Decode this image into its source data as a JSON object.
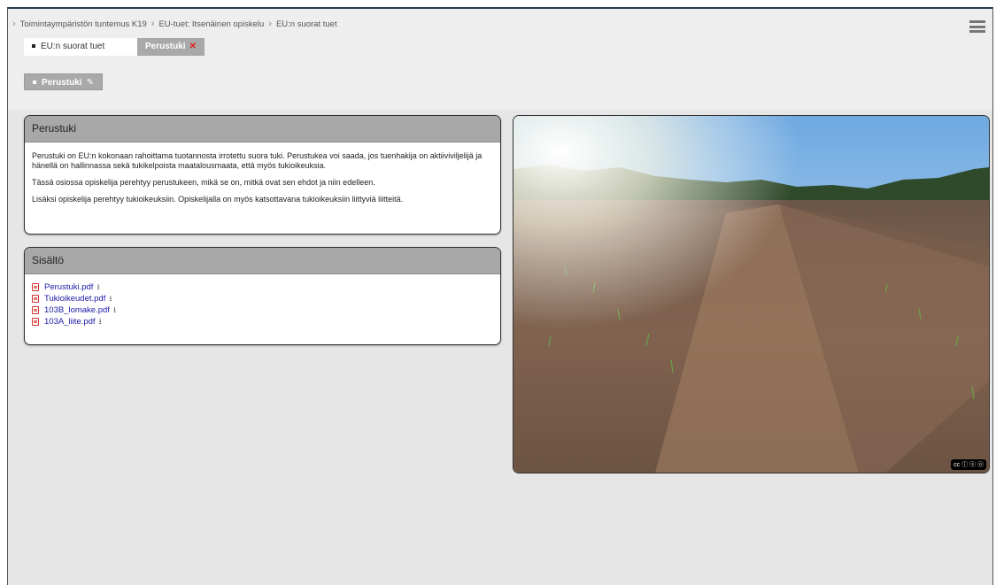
{
  "breadcrumb": {
    "items": [
      "Toimintaympäristön tuntemus K19",
      "EU-tuet: Itsenäinen opiskelu",
      "EU:n suorat tuet"
    ]
  },
  "tabs": {
    "inactive_label": "EU:n suorat tuet",
    "active_label": "Perustuki",
    "close_symbol": "✕"
  },
  "subtab": {
    "label": "Perustuki"
  },
  "info_panel": {
    "title": "Perustuki",
    "paragraphs": [
      "Perustuki on EU:n kokonaan rahoittama tuotannosta irrotettu suora tuki. Perustukea voi saada, jos tuenhakija on aktiiviviljelijä ja hänellä on hallinnassa sekä tukikelpoista maatalousmaata, että myös tukioikeuksia.",
      "Tässä osiossa opiskelija perehtyy perustukeen, mikä se on, mitkä ovat sen ehdot ja niin edelleen.",
      "Lisäksi opiskelija perehtyy tukioikeuksiin. Opiskelijalla on myös katsottavana tukioikeuksiin liittyviä liitteitä."
    ]
  },
  "content_panel": {
    "title": "Sisältö",
    "files": [
      "Perustuki.pdf",
      "Tukioikeudet.pdf",
      "103B_lomake.pdf",
      "103A_liite.pdf"
    ]
  },
  "photo": {
    "license_badge": "cc ⓘ ⓢ ⓞ"
  },
  "colors": {
    "link": "#1a1aa8",
    "pdf_icon": "#d03030",
    "close": "#e02020",
    "panel_header": "#a8a8a8"
  }
}
